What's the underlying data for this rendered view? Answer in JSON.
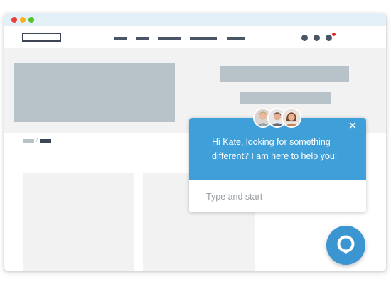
{
  "window": {
    "title_controls": [
      "close",
      "minimize",
      "maximize"
    ]
  },
  "chat": {
    "message": "Hi Kate, looking for something different? I am here to help you!",
    "input_placeholder": "Type and start",
    "close_symbol": "✕",
    "agents": [
      "agent-avatar-1",
      "agent-avatar-2",
      "agent-avatar-3"
    ]
  },
  "icons": {
    "close": "close-icon",
    "launcher": "chat-bubble-icon",
    "notification": "notification-dot"
  },
  "colors": {
    "accent": "#3f9fd8",
    "launcher": "#3b95d0",
    "titlebar": "#e3f0f7",
    "placeholder_block": "#b8c3c9",
    "dark_block": "#3d4656",
    "notification": "#e02a2a"
  }
}
